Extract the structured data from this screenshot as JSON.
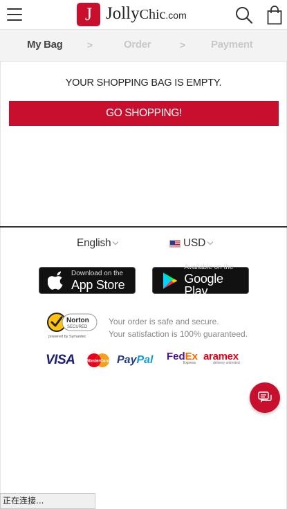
{
  "header": {
    "logo_letter": "J",
    "logo_name_1": "Jolly",
    "logo_name_2": "Chic",
    "logo_suffix": ".com"
  },
  "steps": {
    "items": [
      {
        "label": "My Bag",
        "active": true
      },
      {
        "label": "Order",
        "active": false
      },
      {
        "label": "Payment",
        "active": false
      }
    ],
    "separator": ">"
  },
  "bag": {
    "empty_message": "YOUR SHOPPING BAG IS EMPTY.",
    "go_shopping_label": "GO SHOPPING!"
  },
  "footer": {
    "language": "English",
    "currency": "USD",
    "app_store": {
      "small": "Download on the",
      "big": "App Store"
    },
    "google_play": {
      "small": "Available on the",
      "big": "Google Play"
    },
    "norton": {
      "name": "Norton",
      "secured": "SECURED",
      "powered": "powered by Symantec"
    },
    "secure_line_1": "Your order is safe and secure.",
    "secure_line_2": "Your satisfaction is 100% guaranteed.",
    "payments": {
      "visa": "VISA",
      "mastercard": "MasterCard",
      "paypal_1": "Pay",
      "paypal_2": "Pal",
      "fedex_1": "Fed",
      "fedex_2": "Ex",
      "fedex_sub": "Express",
      "aramex": "aramex",
      "aramex_sub": "delivery unlimited"
    }
  },
  "status_bar": {
    "text": "正在连接..."
  },
  "colors": {
    "brand_red": "#c8102e",
    "step_active": "#444444",
    "step_inactive": "#c8c8c8"
  },
  "icons": {
    "menu": "hamburger-menu-icon",
    "search": "search-icon",
    "bag": "shopping-bag-icon",
    "chat": "chat-bubble-icon",
    "apple": "apple-icon",
    "google_play": "google-play-icon"
  }
}
